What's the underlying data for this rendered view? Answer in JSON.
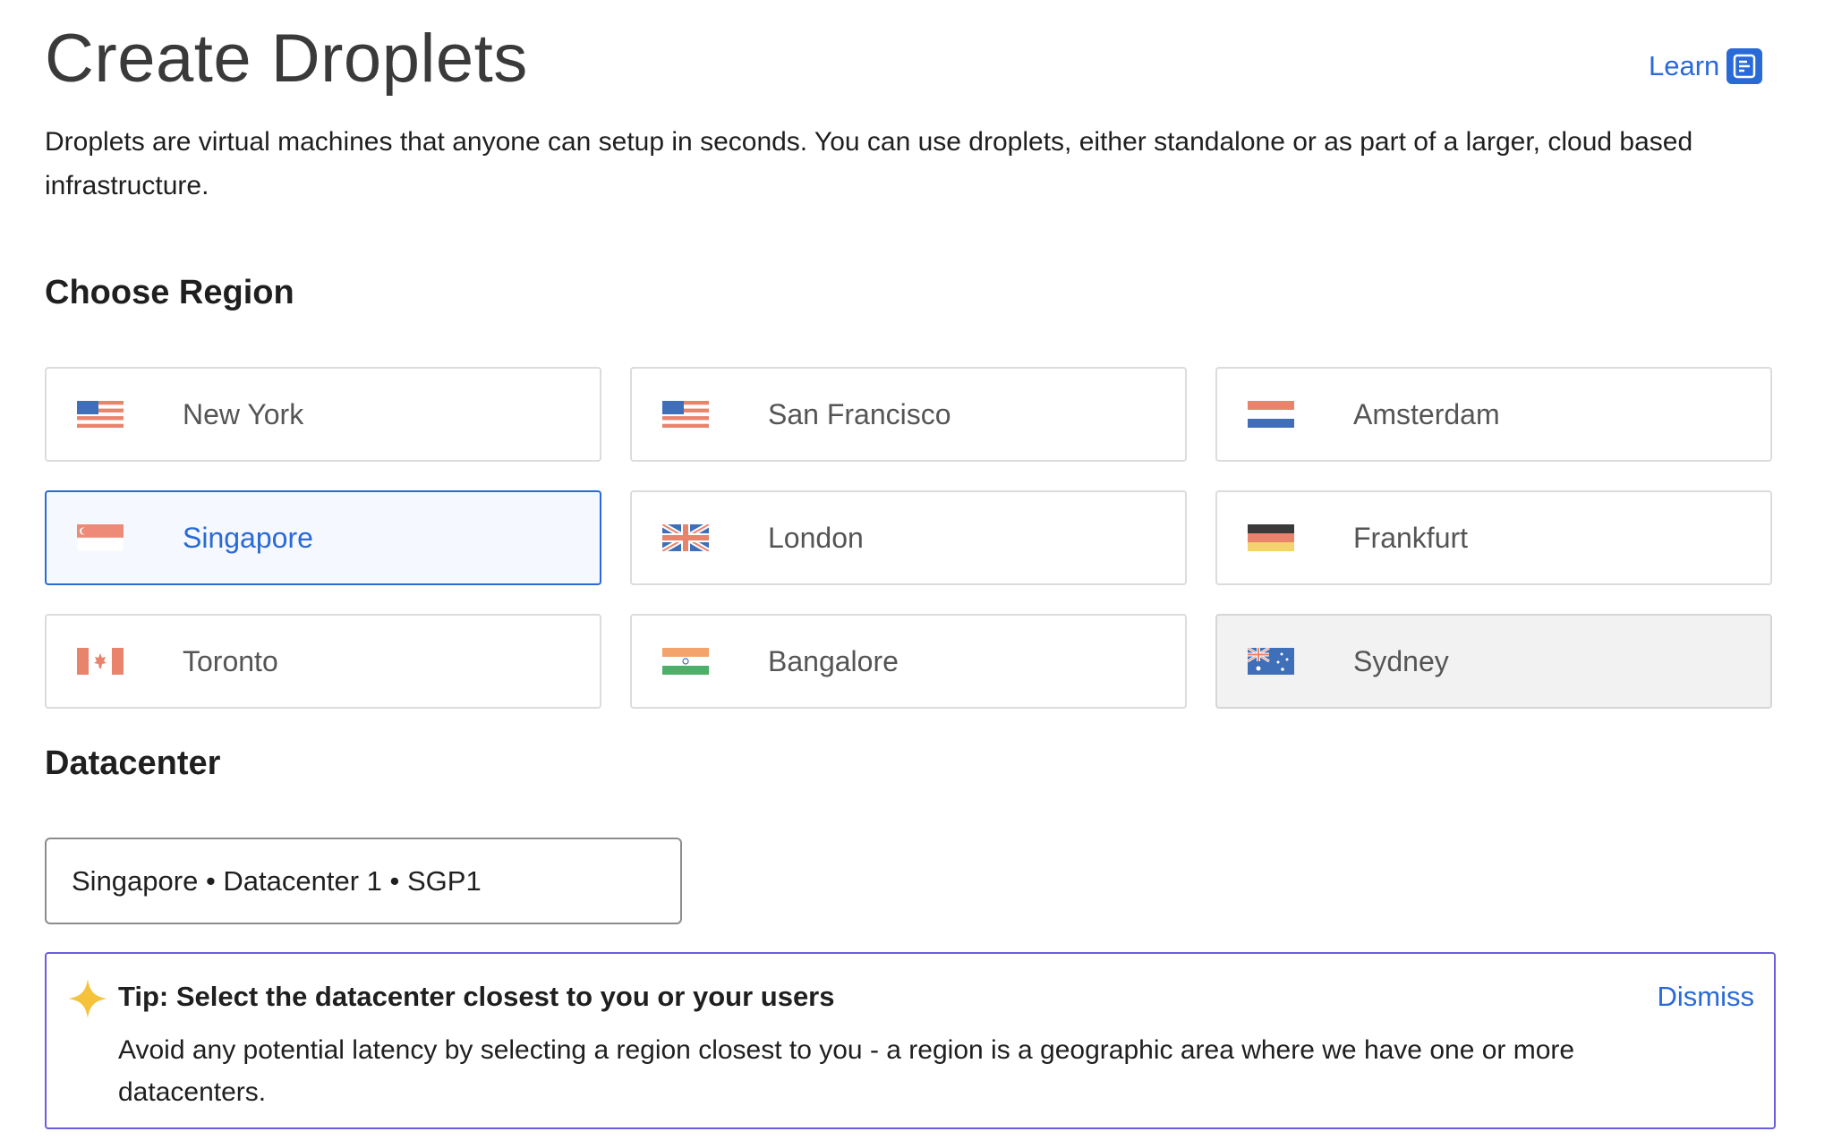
{
  "header": {
    "title": "Create Droplets",
    "learn_label": "Learn",
    "intro": "Droplets are virtual machines that anyone can setup in seconds. You can use droplets, either standalone or as part of a larger, cloud based infrastructure."
  },
  "region_section": {
    "title": "Choose Region",
    "regions": [
      {
        "label": "New York",
        "flag": "us-flag-icon",
        "state": "default"
      },
      {
        "label": "San Francisco",
        "flag": "us-flag-icon",
        "state": "default"
      },
      {
        "label": "Amsterdam",
        "flag": "netherlands-flag-icon",
        "state": "default"
      },
      {
        "label": "Singapore",
        "flag": "singapore-flag-icon",
        "state": "selected"
      },
      {
        "label": "London",
        "flag": "uk-flag-icon",
        "state": "default"
      },
      {
        "label": "Frankfurt",
        "flag": "germany-flag-icon",
        "state": "default"
      },
      {
        "label": "Toronto",
        "flag": "canada-flag-icon",
        "state": "default"
      },
      {
        "label": "Bangalore",
        "flag": "india-flag-icon",
        "state": "default"
      },
      {
        "label": "Sydney",
        "flag": "australia-flag-icon",
        "state": "disabled"
      }
    ]
  },
  "datacenter_section": {
    "title": "Datacenter",
    "selected_value": "Singapore • Datacenter 1 • SGP1"
  },
  "tip": {
    "icon": "sparkle-icon",
    "title": "Tip: Select the datacenter closest to you or your users",
    "dismiss_label": "Dismiss",
    "body": "Avoid any potential latency by selecting a region closest to you - a region is a geographic area where we have one or more datacenters."
  },
  "colors": {
    "accent": "#2a6ad6",
    "tip_border": "#6b5ce0",
    "tip_icon": "#f5c33b",
    "card_border": "#dcdcdc"
  }
}
